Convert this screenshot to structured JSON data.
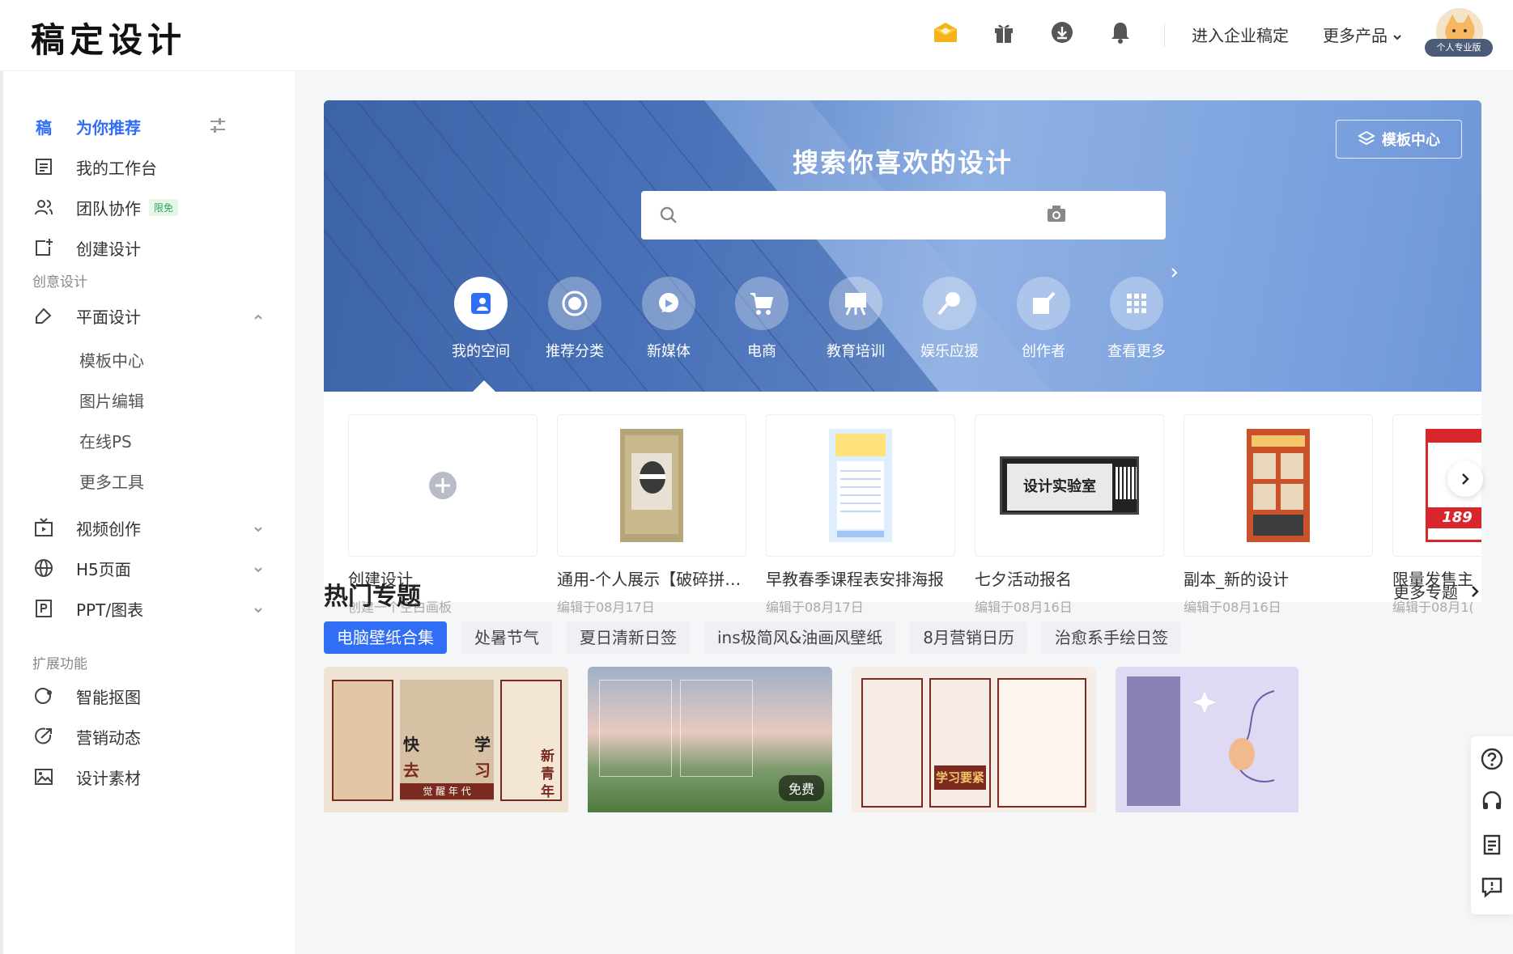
{
  "app": {
    "logo": "稿定设计"
  },
  "header": {
    "enterprise_label": "进入企业稿定",
    "more_products_label": "更多产品",
    "pro_badge": "个人专业版",
    "icons": [
      "vip-crown-icon",
      "gift-icon",
      "download-icon",
      "bell-icon"
    ]
  },
  "sidebar": {
    "recommend_icon_text": "稿",
    "recommend_label": "为你推荐",
    "workspace_label": "我的工作台",
    "team_label": "团队协作",
    "team_badge": "限免",
    "create_label": "创建设计",
    "group_creative": "创意设计",
    "graphic_label": "平面设计",
    "sub_items": [
      "模板中心",
      "图片编辑",
      "在线PS",
      "更多工具"
    ],
    "video_label": "视频创作",
    "h5_label": "H5页面",
    "ppt_label": "PPT/图表",
    "group_extend": "扩展功能",
    "cutout_label": "智能抠图",
    "marketing_label": "营销动态",
    "material_label": "设计素材"
  },
  "banner": {
    "title": "搜索你喜欢的设计",
    "search_placeholder": "",
    "template_center_label": "模板中心",
    "categories": [
      "我的空间",
      "推荐分类",
      "新媒体",
      "电商",
      "教育培训",
      "娱乐应援",
      "创作者",
      "查看更多"
    ]
  },
  "recent": {
    "create_title": "创建设计",
    "create_sub": "创建一个空白画板",
    "cards": [
      {
        "title": "通用-个人展示【破碎拼…",
        "sub": "编辑于08月17日"
      },
      {
        "title": "早教春季课程表安排海报",
        "sub": "编辑于08月17日"
      },
      {
        "title": "七夕活动报名",
        "sub": "编辑于08月16日"
      },
      {
        "title": "副本_新的设计",
        "sub": "编辑于08月16日"
      },
      {
        "title": "限量发售主",
        "sub": "编辑于08月1("
      }
    ],
    "thumb_texts": {
      "lab": "设计实验室",
      "price": "189"
    }
  },
  "hot": {
    "title": "热门专题",
    "more_label": "更多专题",
    "tabs": [
      "电脑壁纸合集",
      "处暑节气",
      "夏日清新日签",
      "ins极简风&油画风壁纸",
      "8月营销日历",
      "治愈系手绘日签"
    ],
    "free_badge": "免费",
    "poster1_texts": [
      "快",
      "学",
      "去",
      "习",
      "觉 醒 年 代",
      "新",
      "青",
      "年"
    ],
    "poster3_text": "学习要紧"
  },
  "colors": {
    "accent": "#2f6ef5",
    "banner": "#5a83c8"
  }
}
